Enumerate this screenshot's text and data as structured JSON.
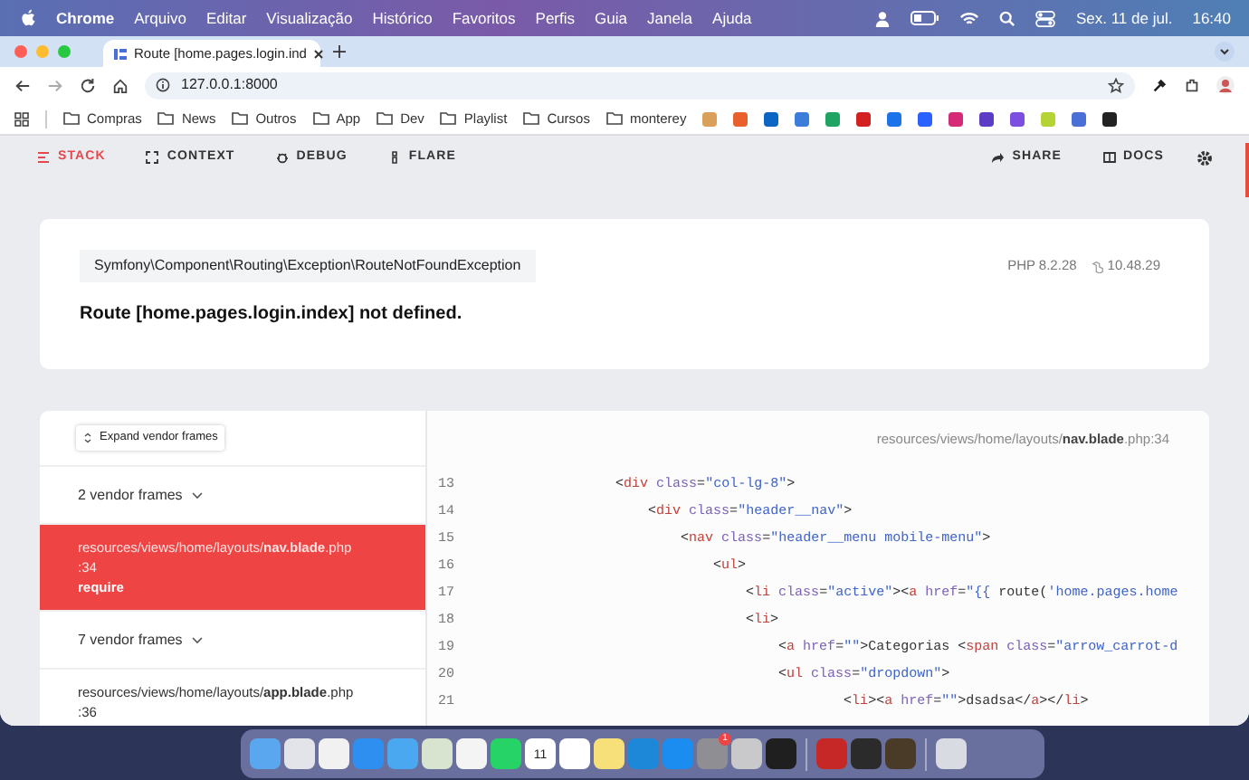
{
  "menu_bar": {
    "app": "Chrome",
    "menus": [
      "Arquivo",
      "Editar",
      "Visualização",
      "Histórico",
      "Favoritos",
      "Perfis",
      "Guia",
      "Janela",
      "Ajuda"
    ],
    "date": "Sex. 11 de jul.",
    "time": "16:40"
  },
  "browser": {
    "tab_title": "Route [home.pages.login.ind",
    "url": "127.0.0.1:8000",
    "bookmarks": [
      "Compras",
      "News",
      "Outros",
      "App",
      "Dev",
      "Playlist",
      "Cursos",
      "monterey"
    ]
  },
  "toolbar": {
    "tabs": [
      {
        "label": "STACK",
        "selected": true
      },
      {
        "label": "CONTEXT",
        "selected": false
      },
      {
        "label": "DEBUG",
        "selected": false
      },
      {
        "label": "FLARE",
        "selected": false
      }
    ],
    "actions": [
      "SHARE",
      "DOCS"
    ]
  },
  "exception": {
    "class": "Symfony\\Component\\Routing\\Exception\\RouteNotFoundException",
    "php_version": "PHP 8.2.28",
    "laravel_version": "10.48.29",
    "message": "Route [home.pages.login.index] not defined."
  },
  "stack": {
    "expand_button": "Expand vendor frames",
    "frames": [
      {
        "kind": "vendor_group",
        "label": "2 vendor frames"
      },
      {
        "kind": "frame",
        "path": "resources/views/home/layouts/**nav.blade**.php",
        "line": ":34",
        "function": "require",
        "selected": true
      },
      {
        "kind": "vendor_group",
        "label": "7 vendor frames"
      },
      {
        "kind": "frame",
        "path": "resources/views/home/layouts/**app.blade**.php",
        "line": ":36",
        "selected": false
      }
    ],
    "file_header": "resources/views/home/layouts/**nav.blade**.php:34",
    "code_lines": [
      {
        "number": "13",
        "tokens": [
          {
            "kind": "text",
            "text": "                <"
          },
          {
            "kind": "tag",
            "text": "div"
          },
          {
            "kind": "attr",
            "text": " class"
          },
          {
            "kind": "text",
            "text": "="
          },
          {
            "kind": "string",
            "text": "\"col-lg-8\""
          },
          {
            "kind": "text",
            "text": ">"
          }
        ]
      },
      {
        "number": "14",
        "tokens": [
          {
            "kind": "text",
            "text": "                    <"
          },
          {
            "kind": "tag",
            "text": "div"
          },
          {
            "kind": "attr",
            "text": " class"
          },
          {
            "kind": "text",
            "text": "="
          },
          {
            "kind": "string",
            "text": "\"header__nav\""
          },
          {
            "kind": "text",
            "text": ">"
          }
        ]
      },
      {
        "number": "15",
        "tokens": [
          {
            "kind": "text",
            "text": "                        <"
          },
          {
            "kind": "tag",
            "text": "nav"
          },
          {
            "kind": "attr",
            "text": " class"
          },
          {
            "kind": "text",
            "text": "="
          },
          {
            "kind": "string",
            "text": "\"header__menu mobile-menu\""
          },
          {
            "kind": "text",
            "text": ">"
          }
        ]
      },
      {
        "number": "16",
        "tokens": [
          {
            "kind": "text",
            "text": "                            <"
          },
          {
            "kind": "tag",
            "text": "ul"
          },
          {
            "kind": "text",
            "text": ">"
          }
        ]
      },
      {
        "number": "17",
        "tokens": [
          {
            "kind": "text",
            "text": "                                <"
          },
          {
            "kind": "tag",
            "text": "li"
          },
          {
            "kind": "attr",
            "text": " class"
          },
          {
            "kind": "text",
            "text": "="
          },
          {
            "kind": "string",
            "text": "\"active\""
          },
          {
            "kind": "text",
            "text": "><"
          },
          {
            "kind": "tag",
            "text": "a"
          },
          {
            "kind": "attr",
            "text": " href"
          },
          {
            "kind": "text",
            "text": "="
          },
          {
            "kind": "string",
            "text": "\"{{"
          },
          {
            "kind": "text",
            "text": " route("
          },
          {
            "kind": "string",
            "text": "'home.pages.home"
          }
        ]
      },
      {
        "number": "18",
        "tokens": [
          {
            "kind": "text",
            "text": "                                <"
          },
          {
            "kind": "tag",
            "text": "li"
          },
          {
            "kind": "text",
            "text": ">"
          }
        ]
      },
      {
        "number": "19",
        "tokens": [
          {
            "kind": "text",
            "text": "                                    <"
          },
          {
            "kind": "tag",
            "text": "a"
          },
          {
            "kind": "attr",
            "text": " href"
          },
          {
            "kind": "text",
            "text": "="
          },
          {
            "kind": "string",
            "text": "\"\""
          },
          {
            "kind": "text",
            "text": ">Categorias <"
          },
          {
            "kind": "tag",
            "text": "span"
          },
          {
            "kind": "attr",
            "text": " class"
          },
          {
            "kind": "text",
            "text": "="
          },
          {
            "kind": "string",
            "text": "\"arrow_carrot-d"
          }
        ]
      },
      {
        "number": "20",
        "tokens": [
          {
            "kind": "text",
            "text": "                                    <"
          },
          {
            "kind": "tag",
            "text": "ul"
          },
          {
            "kind": "attr",
            "text": " class"
          },
          {
            "kind": "text",
            "text": "="
          },
          {
            "kind": "string",
            "text": "\"dropdown\""
          },
          {
            "kind": "text",
            "text": ">"
          }
        ]
      },
      {
        "number": "21",
        "tokens": [
          {
            "kind": "text",
            "text": "                                            <"
          },
          {
            "kind": "tag",
            "text": "li"
          },
          {
            "kind": "text",
            "text": "><"
          },
          {
            "kind": "tag",
            "text": "a"
          },
          {
            "kind": "attr",
            "text": " href"
          },
          {
            "kind": "text",
            "text": "="
          },
          {
            "kind": "string",
            "text": "\"\""
          },
          {
            "kind": "text",
            "text": ">dsadsa</"
          },
          {
            "kind": "tag",
            "text": "a"
          },
          {
            "kind": "text",
            "text": "></"
          },
          {
            "kind": "tag",
            "text": "li"
          },
          {
            "kind": "text",
            "text": ">"
          }
        ]
      }
    ]
  },
  "dock": {
    "calendar_day": "11",
    "settings_badge": "1"
  }
}
